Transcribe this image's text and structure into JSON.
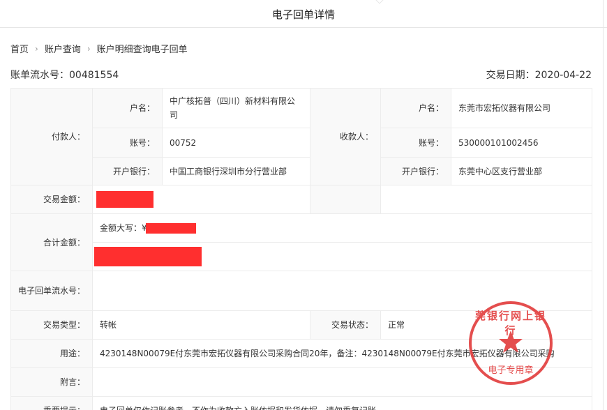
{
  "window": {
    "title": "电子回单详情"
  },
  "breadcrumb": {
    "items": [
      "首页",
      "账户查询",
      "账户明细查询电子回单"
    ],
    "separator": "›"
  },
  "header": {
    "serial_label": "账单流水号：",
    "serial_value": "00481554",
    "date_label": "交易日期：",
    "date_value": "2020-04-22"
  },
  "payer": {
    "section_label": "付款人：",
    "name_label": "户名：",
    "name_value": "中广核拓普（四川）新材料有限公司",
    "account_label": "账号：",
    "account_value": "00752",
    "bank_label": "开户银行：",
    "bank_value": "中国工商银行深圳市分行营业部"
  },
  "payee": {
    "section_label": "收款人：",
    "name_label": "户名：",
    "name_value": "东莞市宏拓仪器有限公司",
    "account_label": "账号：",
    "account_value": "530000101002456",
    "bank_label": "开户银行：",
    "bank_value": "东莞中心区支行营业部"
  },
  "amount": {
    "label": "交易金额："
  },
  "total": {
    "label": "合计金额：",
    "upper_label": "金额大写：",
    "upper_prefix": "¥"
  },
  "receipt_serial": {
    "label": "电子回单流水号：",
    "value": ""
  },
  "trade_type": {
    "label": "交易类型：",
    "value": "转帐"
  },
  "trade_status": {
    "label": "交易状态：",
    "value": "正常"
  },
  "purpose": {
    "label": "用途：",
    "value": "4230148N00079E付东莞市宏拓仪器有限公司采购合同20年，备注：4230148N00079E付东莞市宏拓仪器有限公司采购"
  },
  "postscript": {
    "label": "附言：",
    "value": ""
  },
  "notice": {
    "label": "重要提示：",
    "value": "电子回单仅作记账参考，不作为收款方入账依据和发货依据，请勿重复记账"
  },
  "stamp": {
    "arc_text": "莞银行网上银行",
    "bottom_text": "电子专用章",
    "color": "#e23b3b"
  },
  "colors": {
    "redaction": "#ff2f2f",
    "label_bg": "#f9f9f9",
    "border": "#ececec"
  }
}
